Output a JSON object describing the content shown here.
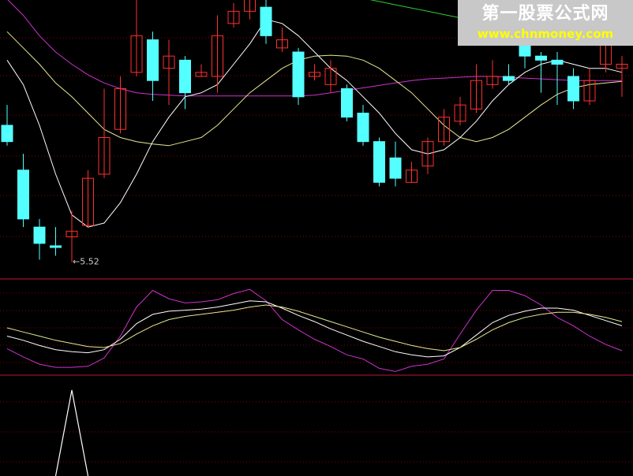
{
  "watermark": {
    "title": "第一股票公式网",
    "url": "www.chnmoney.com"
  },
  "colors": {
    "background": "#000000",
    "up_candle": "#ff3030",
    "down_candle": "#54ffff",
    "ma_green": "#33cc33",
    "ma_magenta": "#cc33cc",
    "ma_yellow": "#e8e890",
    "ma_white": "#ffffff",
    "gridline": "#8b0000",
    "separator": "#c0143c"
  },
  "chart_data": [
    {
      "type": "candlestick",
      "panel": "price",
      "grid": "dotted horizontal",
      "annotations": [
        {
          "text": "←5.52",
          "candle_index": 4,
          "kind": "low"
        }
      ],
      "y_range": [
        5.4,
        8.4
      ],
      "candles": [
        {
          "open": 7.2,
          "close": 7.0,
          "high": 7.45,
          "low": 6.95
        },
        {
          "open": 6.65,
          "close": 6.05,
          "high": 6.85,
          "low": 5.95
        },
        {
          "open": 5.95,
          "close": 5.75,
          "high": 6.05,
          "low": 5.55
        },
        {
          "open": 5.72,
          "close": 5.7,
          "high": 5.95,
          "low": 5.6
        },
        {
          "open": 5.83,
          "close": 5.9,
          "high": 6.15,
          "low": 5.52
        },
        {
          "open": 5.97,
          "close": 6.55,
          "high": 6.65,
          "low": 5.95
        },
        {
          "open": 6.6,
          "close": 7.05,
          "high": 7.65,
          "low": 6.55
        },
        {
          "open": 7.15,
          "close": 7.65,
          "high": 7.8,
          "low": 7.1
        },
        {
          "open": 7.85,
          "close": 8.3,
          "high": 8.9,
          "low": 7.8
        },
        {
          "open": 8.25,
          "close": 7.75,
          "high": 8.35,
          "low": 7.5
        },
        {
          "open": 7.9,
          "close": 8.05,
          "high": 8.25,
          "low": 7.45
        },
        {
          "open": 8.0,
          "close": 7.6,
          "high": 8.05,
          "low": 7.4
        },
        {
          "open": 7.8,
          "close": 7.85,
          "high": 7.95,
          "low": 7.8
        },
        {
          "open": 7.8,
          "close": 8.3,
          "high": 8.55,
          "low": 7.6
        },
        {
          "open": 8.45,
          "close": 8.6,
          "high": 8.7,
          "low": 8.4
        },
        {
          "open": 8.6,
          "close": 8.8,
          "high": 8.95,
          "low": 8.5
        },
        {
          "open": 8.65,
          "close": 8.3,
          "high": 8.75,
          "low": 8.2
        },
        {
          "open": 8.15,
          "close": 8.25,
          "high": 8.4,
          "low": 8.1
        },
        {
          "open": 8.1,
          "close": 7.55,
          "high": 8.15,
          "low": 7.45
        },
        {
          "open": 7.8,
          "close": 7.85,
          "high": 7.95,
          "low": 7.75
        },
        {
          "open": 7.7,
          "close": 7.9,
          "high": 8.0,
          "low": 7.6
        },
        {
          "open": 7.65,
          "close": 7.3,
          "high": 7.7,
          "low": 7.25
        },
        {
          "open": 7.35,
          "close": 7.0,
          "high": 7.45,
          "low": 6.95
        },
        {
          "open": 7.0,
          "close": 6.5,
          "high": 7.05,
          "low": 6.45
        },
        {
          "open": 6.8,
          "close": 6.55,
          "high": 7.0,
          "low": 6.45
        },
        {
          "open": 6.5,
          "close": 6.65,
          "high": 6.75,
          "low": 6.5
        },
        {
          "open": 6.7,
          "close": 7.0,
          "high": 7.05,
          "low": 6.6
        },
        {
          "open": 7.0,
          "close": 7.3,
          "high": 7.4,
          "low": 6.95
        },
        {
          "open": 7.25,
          "close": 7.45,
          "high": 7.55,
          "low": 7.2
        },
        {
          "open": 7.4,
          "close": 7.75,
          "high": 7.95,
          "low": 7.35
        },
        {
          "open": 7.7,
          "close": 7.8,
          "high": 8.0,
          "low": 7.65
        },
        {
          "open": 7.8,
          "close": 7.75,
          "high": 7.95,
          "low": 7.7
        },
        {
          "open": 8.25,
          "close": 8.05,
          "high": 8.55,
          "low": 7.9
        },
        {
          "open": 8.05,
          "close": 8.0,
          "high": 8.1,
          "low": 7.6
        },
        {
          "open": 8.0,
          "close": 7.95,
          "high": 8.1,
          "low": 7.45
        },
        {
          "open": 7.8,
          "close": 7.5,
          "high": 7.9,
          "low": 7.4
        },
        {
          "open": 7.5,
          "close": 7.75,
          "high": 7.9,
          "low": 7.45
        },
        {
          "open": 7.95,
          "close": 8.25,
          "high": 8.95,
          "low": 7.85
        },
        {
          "open": 7.9,
          "close": 7.95,
          "high": 8.05,
          "low": 7.55
        }
      ],
      "series": [
        {
          "color": "#33cc33",
          "values": [
            9.0,
            9.0,
            8.99,
            8.99,
            8.98,
            8.98,
            8.97,
            8.96,
            8.95,
            8.94,
            8.93,
            8.92,
            8.92,
            8.91,
            8.91,
            8.9,
            8.9,
            8.89,
            8.88,
            8.86,
            8.84,
            8.8,
            8.76,
            8.72,
            8.68,
            8.64,
            8.6,
            8.56,
            8.52,
            8.48,
            8.44,
            8.41,
            8.38,
            8.35,
            8.32,
            8.29,
            8.26,
            8.23,
            8.2
          ]
        },
        {
          "color": "#cc33cc",
          "values": [
            8.75,
            8.55,
            8.3,
            8.1,
            7.95,
            7.82,
            7.72,
            7.65,
            7.6,
            7.58,
            7.57,
            7.56,
            7.56,
            7.56,
            7.56,
            7.56,
            7.56,
            7.56,
            7.56,
            7.57,
            7.6,
            7.63,
            7.66,
            7.69,
            7.72,
            7.75,
            7.77,
            7.78,
            7.79,
            7.8,
            7.8,
            7.79,
            7.78,
            7.77,
            7.76,
            7.75,
            7.75,
            7.75,
            7.75
          ]
        },
        {
          "color": "#e8e890",
          "values": [
            8.35,
            8.15,
            7.95,
            7.72,
            7.55,
            7.35,
            7.15,
            7.05,
            7.0,
            6.97,
            6.95,
            7.0,
            7.05,
            7.2,
            7.4,
            7.6,
            7.75,
            7.9,
            8.0,
            8.05,
            8.06,
            8.05,
            8.0,
            7.9,
            7.75,
            7.6,
            7.4,
            7.2,
            7.05,
            7.0,
            7.05,
            7.15,
            7.3,
            7.45,
            7.58,
            7.66,
            7.7,
            7.72,
            7.74
          ]
        },
        {
          "color": "#ffffff",
          "values": [
            8.0,
            7.7,
            7.2,
            6.6,
            6.1,
            5.95,
            6.0,
            6.25,
            6.6,
            7.0,
            7.3,
            7.55,
            7.6,
            7.7,
            7.95,
            8.2,
            8.5,
            8.45,
            8.3,
            8.1,
            7.9,
            7.75,
            7.55,
            7.35,
            7.1,
            6.9,
            6.85,
            6.9,
            7.05,
            7.25,
            7.5,
            7.7,
            7.85,
            7.95,
            8.0,
            7.95,
            7.9,
            7.9,
            7.85
          ]
        }
      ]
    },
    {
      "type": "line",
      "panel": "oscillator",
      "grid": "dotted horizontal",
      "y_range": [
        -2.2,
        2.2
      ],
      "series": [
        {
          "color": "#cc33cc",
          "values": [
            -1.0,
            -1.4,
            -1.75,
            -1.9,
            -1.9,
            -1.85,
            -1.45,
            -0.4,
            1.0,
            1.8,
            1.4,
            1.2,
            1.25,
            1.35,
            1.65,
            1.85,
            1.3,
            0.4,
            -0.1,
            -0.55,
            -0.9,
            -1.3,
            -1.5,
            -1.95,
            -2.1,
            -1.85,
            -1.75,
            -1.5,
            -0.3,
            0.85,
            1.8,
            1.8,
            1.55,
            1.1,
            0.5,
            0.1,
            -0.4,
            -0.8,
            -1.1
          ]
        },
        {
          "color": "#ffffff",
          "values": [
            -0.4,
            -0.6,
            -0.85,
            -1.05,
            -1.15,
            -1.2,
            -1.05,
            -0.55,
            0.2,
            0.65,
            0.8,
            0.85,
            0.9,
            1.0,
            1.15,
            1.3,
            1.25,
            0.95,
            0.6,
            0.3,
            -0.05,
            -0.35,
            -0.65,
            -0.9,
            -1.15,
            -1.3,
            -1.4,
            -1.35,
            -0.95,
            -0.35,
            0.25,
            0.6,
            0.8,
            0.95,
            0.95,
            0.85,
            0.6,
            0.35,
            0.1
          ]
        },
        {
          "color": "#e8e890",
          "values": [
            0.0,
            -0.2,
            -0.4,
            -0.6,
            -0.75,
            -0.9,
            -0.95,
            -0.75,
            -0.3,
            0.1,
            0.4,
            0.55,
            0.65,
            0.75,
            0.85,
            1.0,
            1.1,
            1.0,
            0.8,
            0.55,
            0.3,
            0.05,
            -0.2,
            -0.45,
            -0.65,
            -0.85,
            -1.0,
            -1.1,
            -0.95,
            -0.55,
            -0.1,
            0.25,
            0.5,
            0.65,
            0.75,
            0.75,
            0.65,
            0.5,
            0.3
          ]
        }
      ]
    },
    {
      "type": "line",
      "panel": "signal",
      "grid": "dotted horizontal",
      "y_range": [
        0,
        1
      ],
      "series": [
        {
          "color": "#ffffff",
          "values": [
            0,
            0,
            0,
            0,
            1,
            0,
            0,
            0,
            0,
            0,
            0,
            0,
            0,
            0,
            0,
            0,
            0,
            0,
            0,
            0,
            0,
            0,
            0,
            0,
            0,
            0,
            0,
            0,
            0,
            0,
            0,
            0,
            0,
            0,
            0,
            0,
            0,
            0,
            0
          ]
        }
      ]
    }
  ]
}
